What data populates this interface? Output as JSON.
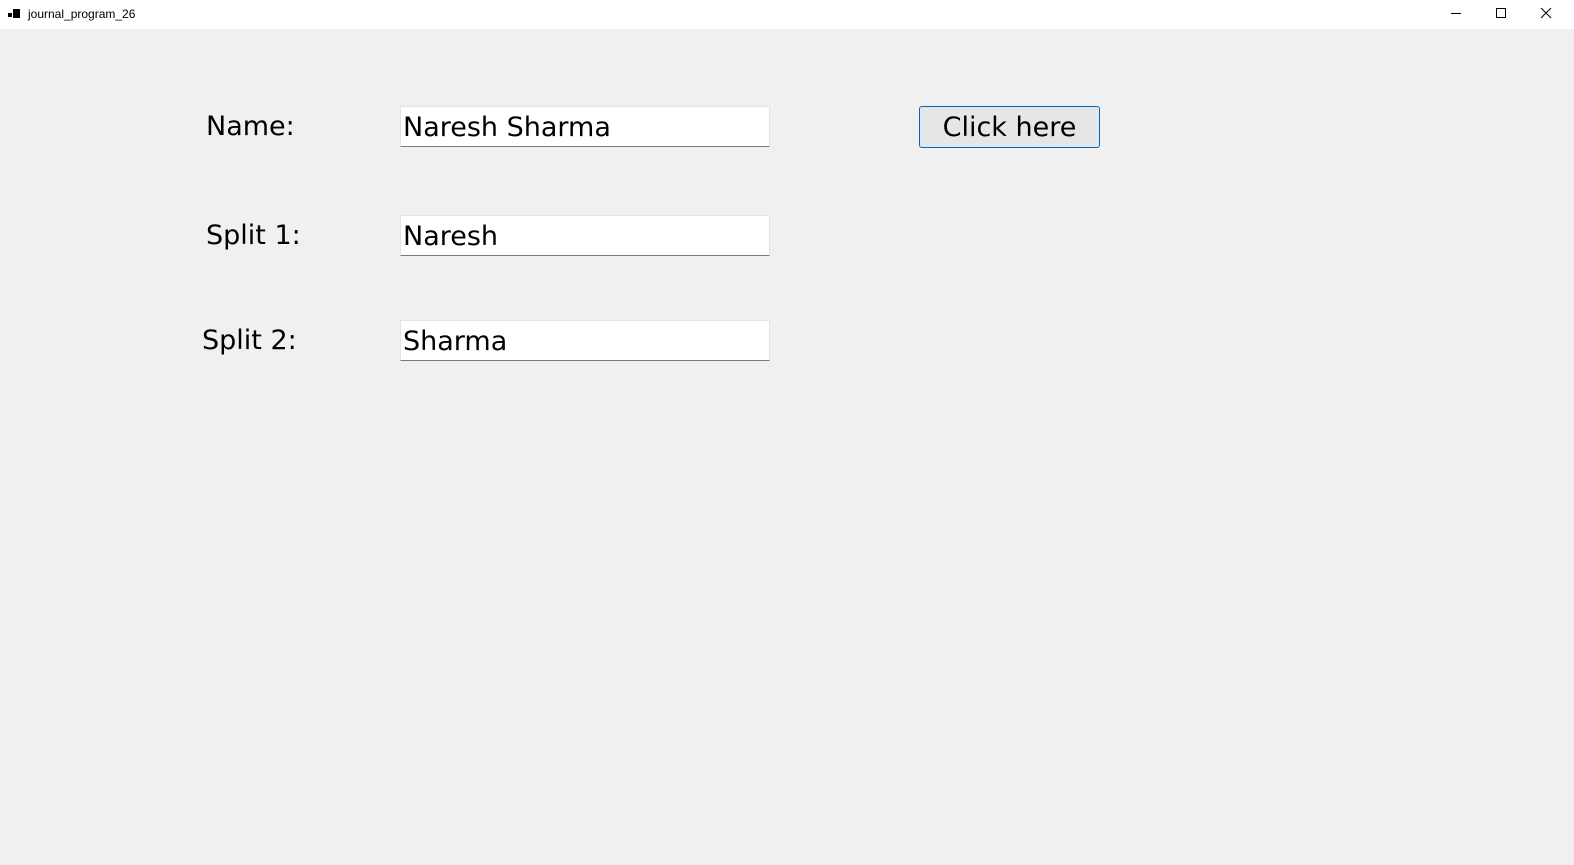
{
  "window": {
    "title": "journal_program_26",
    "icon": "app-icon",
    "controls": {
      "minimize_icon": "minimize-icon",
      "maximize_icon": "maximize-icon",
      "close_icon": "close-icon"
    }
  },
  "form": {
    "name_label": "Name:",
    "name_value": "Naresh Sharma",
    "split1_label": "Split 1:",
    "split1_value": "Naresh",
    "split2_label": "Split 2:",
    "split2_value": "Sharma",
    "button_label": "Click here"
  },
  "colors": {
    "background": "#f0f0f0",
    "titlebar": "#ffffff",
    "button_border": "#0067c0"
  }
}
